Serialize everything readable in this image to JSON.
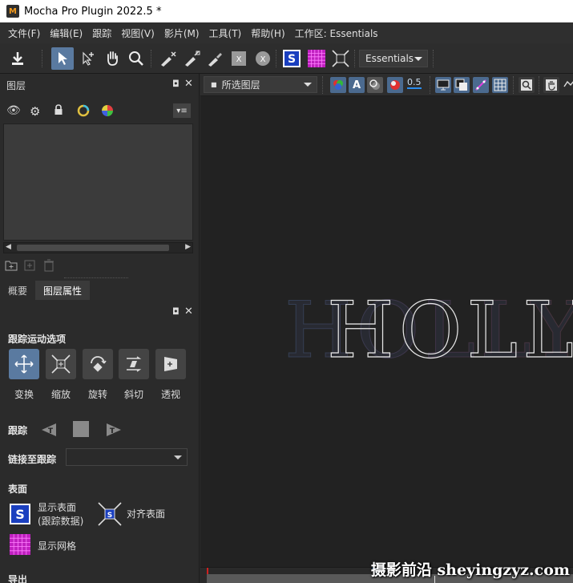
{
  "window": {
    "title": "Mocha Pro Plugin 2022.5 *",
    "logo_letter": "M"
  },
  "menu": [
    "文件(F)",
    "编辑(E)",
    "跟踪",
    "视图(V)",
    "影片(M)",
    "工具(T)",
    "帮助(H)",
    "工作区: Essentials"
  ],
  "toolbar": {
    "workspace": "Essentials"
  },
  "layers_panel": {
    "title": "图层"
  },
  "tabs": [
    "概要",
    "图层属性"
  ],
  "track_options": {
    "heading": "跟踪运动选项",
    "modes": [
      "变换",
      "缩放",
      "旋转",
      "斜切",
      "透视"
    ],
    "track_label": "跟踪",
    "link_label": "链接至跟踪"
  },
  "surface": {
    "heading": "表面",
    "show_surface": "显示表面",
    "show_surface_sub": "(跟踪数据)",
    "align_surface": "对齐表面",
    "show_grid": "显示网格"
  },
  "export": {
    "heading": "导出"
  },
  "viewer_toolbar": {
    "layer_selector": "所选图层",
    "opacity": "0.5"
  },
  "viewer": {
    "text": "HOLLY"
  },
  "watermark": "摄影前沿 sheyingzyz.com",
  "colors": {
    "accent": "#5a7aa0",
    "grid_magenta": "#c020c0",
    "surface_blue": "#1a3fbf",
    "timeline_marker": "#2a8df0"
  }
}
